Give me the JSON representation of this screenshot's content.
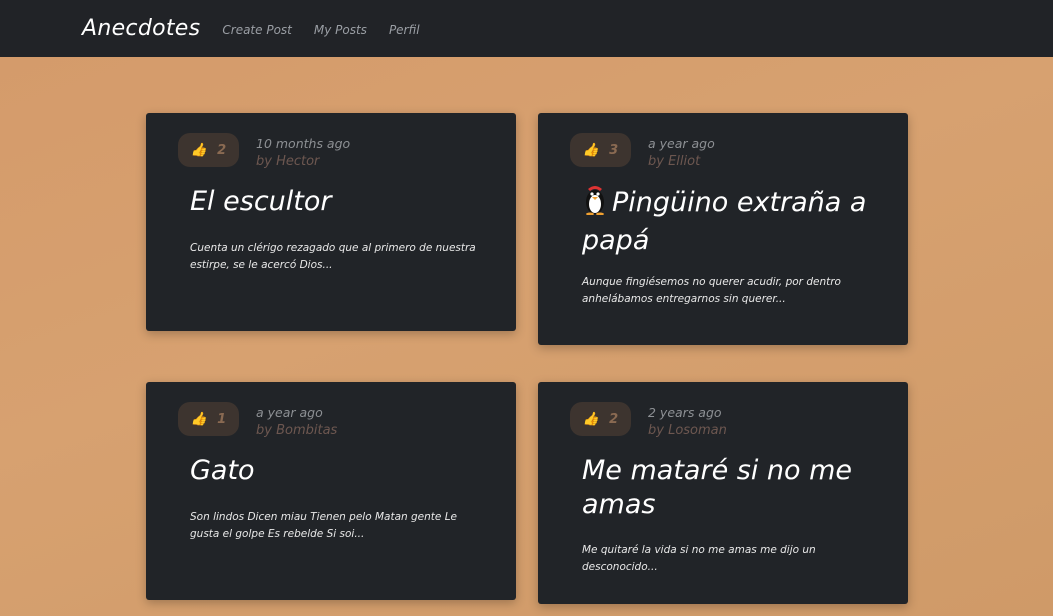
{
  "nav": {
    "brand": "Anecdotes",
    "links": [
      "Create Post",
      "My Posts",
      "Perfil"
    ]
  },
  "posts": [
    {
      "likes": "2",
      "ago": "10 months ago",
      "author": "by Hector",
      "title": "El escultor",
      "excerpt": "Cuenta un clérigo rezagado que al primero de nuestra estirpe, se le acercó Dios..."
    },
    {
      "likes": "3",
      "ago": "a year ago",
      "author": "by Elliot",
      "title_icon": "penguin-emoji",
      "title": "Pingüino extraña a papá",
      "excerpt": "Aunque fingiésemos no querer acudir, por dentro anhelábamos entregarnos sin querer..."
    },
    {
      "likes": "1",
      "ago": "a year ago",
      "author": "by Bombitas",
      "title": "Gato",
      "excerpt": "Son lindos Dicen miau Tienen pelo Matan gente Le gusta el golpe Es rebelde Si soi..."
    },
    {
      "likes": "2",
      "ago": "2 years ago",
      "author": "by Losoman",
      "title": "Me mataré si no me amas",
      "excerpt": "Me quitaré la vida si no me amas me dijo un desconocido..."
    }
  ],
  "colors": {
    "navbar": "#212327",
    "card": "#212428",
    "background": "#d49a6a",
    "like_badge": "#3d342f",
    "thumb_icon": "#e0b04a"
  }
}
